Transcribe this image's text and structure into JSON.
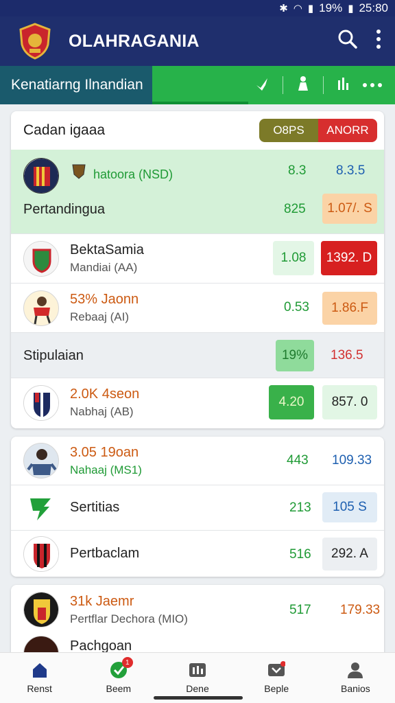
{
  "status_bar": {
    "battery": "19%",
    "time": "25:80"
  },
  "app_bar": {
    "title": "OLAHRAGANIA"
  },
  "sub_header": {
    "label": "Kenatiarng Ilnandian"
  },
  "card1": {
    "title": "Cadan igaaa",
    "toggle": {
      "left": "O8PS",
      "right": "ANORR"
    },
    "header_row": {
      "sub": "hatoora (NSD)",
      "v1": "8.3",
      "v2": "8.3.5"
    },
    "section_row": {
      "label": "Pertandingua",
      "v1": "825",
      "v2": "1.07/. S"
    },
    "rows": [
      {
        "name": "BektaSamia",
        "sub": "Mandiai (AA)",
        "v1": "1.08",
        "v2": "1392. D"
      },
      {
        "name": "53% Jaonn",
        "sub": "Rebaaj (AI)",
        "v1": "0.53",
        "v2": "1.86.F"
      }
    ],
    "stip_row": {
      "label": "Stipulaian",
      "v1": "19%",
      "v2": "136.5"
    },
    "last_row": {
      "name": "2.0K 4seon",
      "sub": "Nabhaj (AB)",
      "v1": "4.20",
      "v2": "857. 0"
    }
  },
  "card2": {
    "rows": [
      {
        "name": "3.05 19oan",
        "sub": "Nahaaj (MS1)",
        "v1": "443",
        "v2": "109.33"
      },
      {
        "name": "Sertitias",
        "v1": "213",
        "v2": "105 S"
      },
      {
        "name": "Pertbaclam",
        "v1": "516",
        "v2": "292. A"
      }
    ]
  },
  "card3": {
    "rows": [
      {
        "name": "31k Jaemr",
        "sub": "Pertflar Dechora (MIO)",
        "v1": "517",
        "v2": "179.33"
      },
      {
        "name": "Pachgoan"
      }
    ]
  },
  "bottom_nav": [
    {
      "label": "Renst",
      "icon": "home-icon"
    },
    {
      "label": "Beem",
      "icon": "sports-ball-icon",
      "badge": "1"
    },
    {
      "label": "Dene",
      "icon": "stats-icon"
    },
    {
      "label": "Beple",
      "icon": "ticket-icon"
    },
    {
      "label": "Banios",
      "icon": "profile-icon"
    }
  ],
  "colors": {
    "app_bar": "#1f2f6d",
    "accent_green": "#27b24a",
    "teal": "#1a5a6c",
    "red": "#d72e2e"
  }
}
